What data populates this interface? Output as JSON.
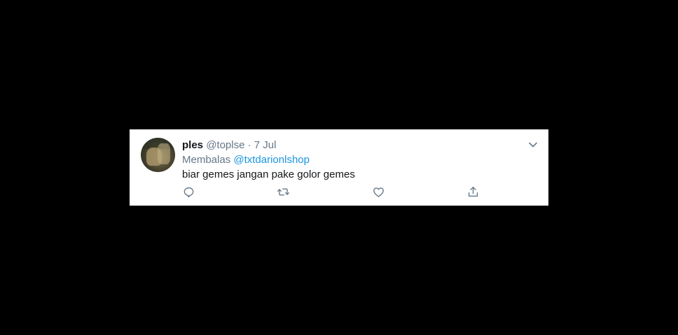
{
  "tweet": {
    "display_name": "ples",
    "handle": "@toplse",
    "separator": " · ",
    "date": "7 Jul",
    "reply_prefix": "Membalas ",
    "reply_to": "@txtdarionlshop",
    "text": "biar gemes jangan pake golor gemes"
  },
  "colors": {
    "background": "#000000",
    "card": "#ffffff",
    "text": "#14171a",
    "secondary": "#657786",
    "link": "#1b95e0"
  },
  "icons": [
    "chevron-down-icon",
    "reply-icon",
    "retweet-icon",
    "like-icon",
    "share-icon"
  ]
}
